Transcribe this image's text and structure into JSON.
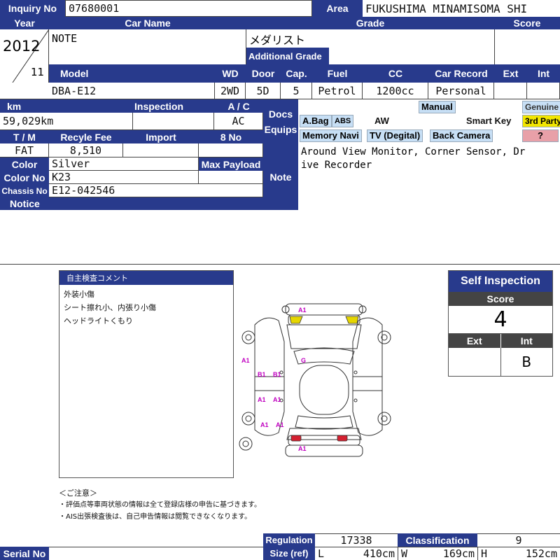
{
  "header": {
    "inquiry_label": "Inquiry No",
    "inquiry_value": "07680001",
    "area_label": "Area",
    "area_value": "FUKUSHIMA MINAMISOMA SHI",
    "year_label": "Year",
    "carname_label": "Car Name",
    "grade_label": "Grade",
    "score_label": "Score",
    "year_value": "2012",
    "month_value": "11",
    "carname_value": "NOTE",
    "grade_value": "メダリスト",
    "additional_grade_label": "Additional Grade",
    "additional_grade_value": "",
    "score_value": ""
  },
  "specs": {
    "labels": {
      "model": "Model",
      "wd": "WD",
      "door": "Door",
      "cap": "Cap.",
      "fuel": "Fuel",
      "cc": "CC",
      "record": "Car Record",
      "ext": "Ext",
      "int": "Int"
    },
    "values": {
      "model": "DBA-E12",
      "wd": "2WD",
      "door": "5D",
      "cap": "5",
      "fuel": "Petrol",
      "cc": "1200cc",
      "record": "Personal",
      "ext": "",
      "int": ""
    }
  },
  "details": {
    "km_label": "km",
    "inspection_label": "Inspection",
    "ac_label": "A / C",
    "km_value": "59,029km",
    "inspection_value": "",
    "ac_value": "AC",
    "tm_label": "T / M",
    "recycle_label": "Recyle Fee",
    "import_label": "Import",
    "no8_label": "8 No",
    "tm_value": "FAT",
    "recycle_value": "8,510",
    "import_value": "",
    "no8_value": "",
    "color_label": "Color",
    "color_value": "Silver",
    "maxpayload_label": "Max Payload",
    "maxpayload_value": "",
    "colorno_label": "Color No",
    "colorno_value": "K23",
    "chassis_label": "Chassis No",
    "chassis_value": "E12-042546",
    "notice_label": "Notice",
    "notice_value": ""
  },
  "docs": {
    "docs_label": "Docs",
    "equips_label": "Equips",
    "manual": "Manual",
    "genuine": "Genuine",
    "abag": "A.Bag",
    "abs": "ABS",
    "aw": "AW",
    "smartkey": "Smart Key",
    "thirdparty": "3rd Party",
    "memorynavi": "Memory Navi",
    "tv": "TV (Degital)",
    "backcamera": "Back Camera",
    "question": "?"
  },
  "note": {
    "label": "Note",
    "line1": "Around View Monitor, Corner Sensor, Dr",
    "line2": "ive Recorder"
  },
  "comment": {
    "title": "自主検査コメント",
    "lines": [
      "外装小傷",
      "シート擦れ小、内張り小傷",
      "ヘッドライトくもり"
    ]
  },
  "diagram_marks": {
    "front": "A1",
    "left_front": "A1",
    "g": "G",
    "b1a": "B1",
    "b1b": "B1",
    "a1a": "A1",
    "a1b": "A1",
    "a1c": "A1",
    "a1d": "A1",
    "rear": "A1"
  },
  "caution": {
    "title": "＜ご注意＞",
    "line1": "・評価点等車両状態の情報は全て登録店様の申告に基づきます。",
    "line2": "・AIS出張検査後は、自己申告情報は閲覧できなくなります。"
  },
  "self_inspection": {
    "title": "Self Inspection",
    "score_label": "Score",
    "score_value": "4",
    "ext_label": "Ext",
    "int_label": "Int",
    "ext_value": "",
    "int_value": "B"
  },
  "footer": {
    "regulation_label": "Regulation",
    "regulation_value": "17338",
    "classification_label": "Classification",
    "classification_value": "9",
    "size_label": "Size (ref)",
    "l_label": "L",
    "l_value": "410cm",
    "w_label": "W",
    "w_value": "169cm",
    "h_label": "H",
    "h_value": "152cm",
    "serial_label": "Serial No",
    "serial_value": ""
  },
  "colors": {
    "header_bg": "#283a8c",
    "equip_on": "#c7dff5",
    "third_party": "#f2e600",
    "question": "#e8a0a8",
    "damage_mark": "#c000c0"
  }
}
